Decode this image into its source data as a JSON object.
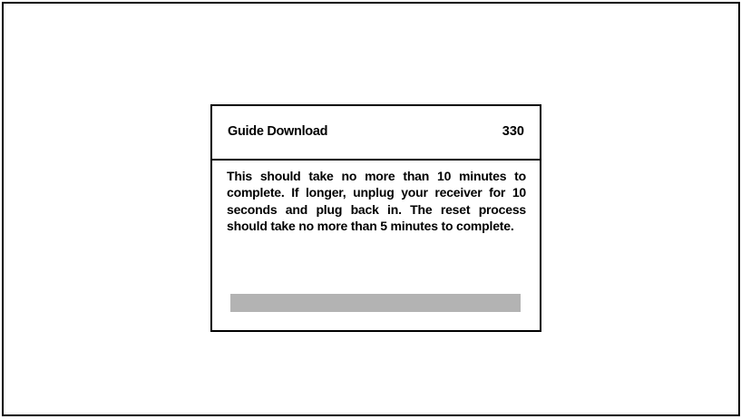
{
  "dialog": {
    "title": "Guide Download",
    "code": "330",
    "message": "This should take no more than 10 minutes to complete. If longer, unplug your receiver for 10 seconds and plug back in. The reset process should take no more than 5 minutes to complete."
  },
  "progress": {
    "fraction": 1.0,
    "fill_color": "#b3b3b3"
  },
  "colors": {
    "background": "#ffffff",
    "border": "#000000",
    "text": "#000000"
  }
}
